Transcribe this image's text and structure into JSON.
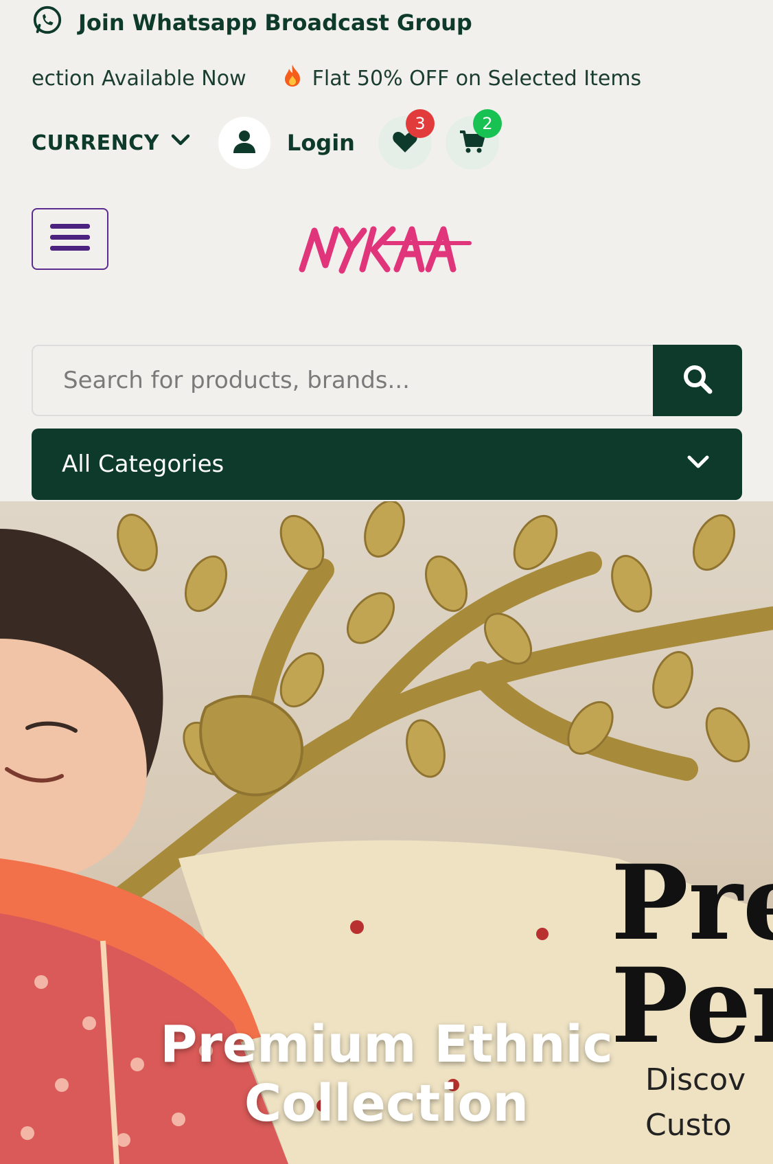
{
  "topbar": {
    "whatsapp_label": "Join Whatsapp Broadcast Group",
    "icon": "whatsapp-icon"
  },
  "announcements": [
    "ection Available Now",
    "Flat 50% OFF on Selected Items"
  ],
  "toolbar": {
    "currency_label": "CURRENCY",
    "login_label": "Login",
    "wishlist_count": "3",
    "cart_count": "2"
  },
  "header": {
    "logo_text": "NYKAA",
    "logo_color": "#e0357a"
  },
  "search": {
    "placeholder": "Search for products, brands..."
  },
  "categories": {
    "label": "All Categories"
  },
  "hero": {
    "title_line1": "Premium Ethnic",
    "title_line2": "Collection",
    "banner_line1": "Pre",
    "banner_line2": "Per",
    "banner_line3": "Discov",
    "banner_line4": "Custo"
  },
  "colors": {
    "primary": "#0e3a2b",
    "background": "#f1f0ed",
    "menu_border": "#5b2c8e",
    "badge_wishlist": "#e23b3b",
    "badge_cart": "#18c252"
  }
}
